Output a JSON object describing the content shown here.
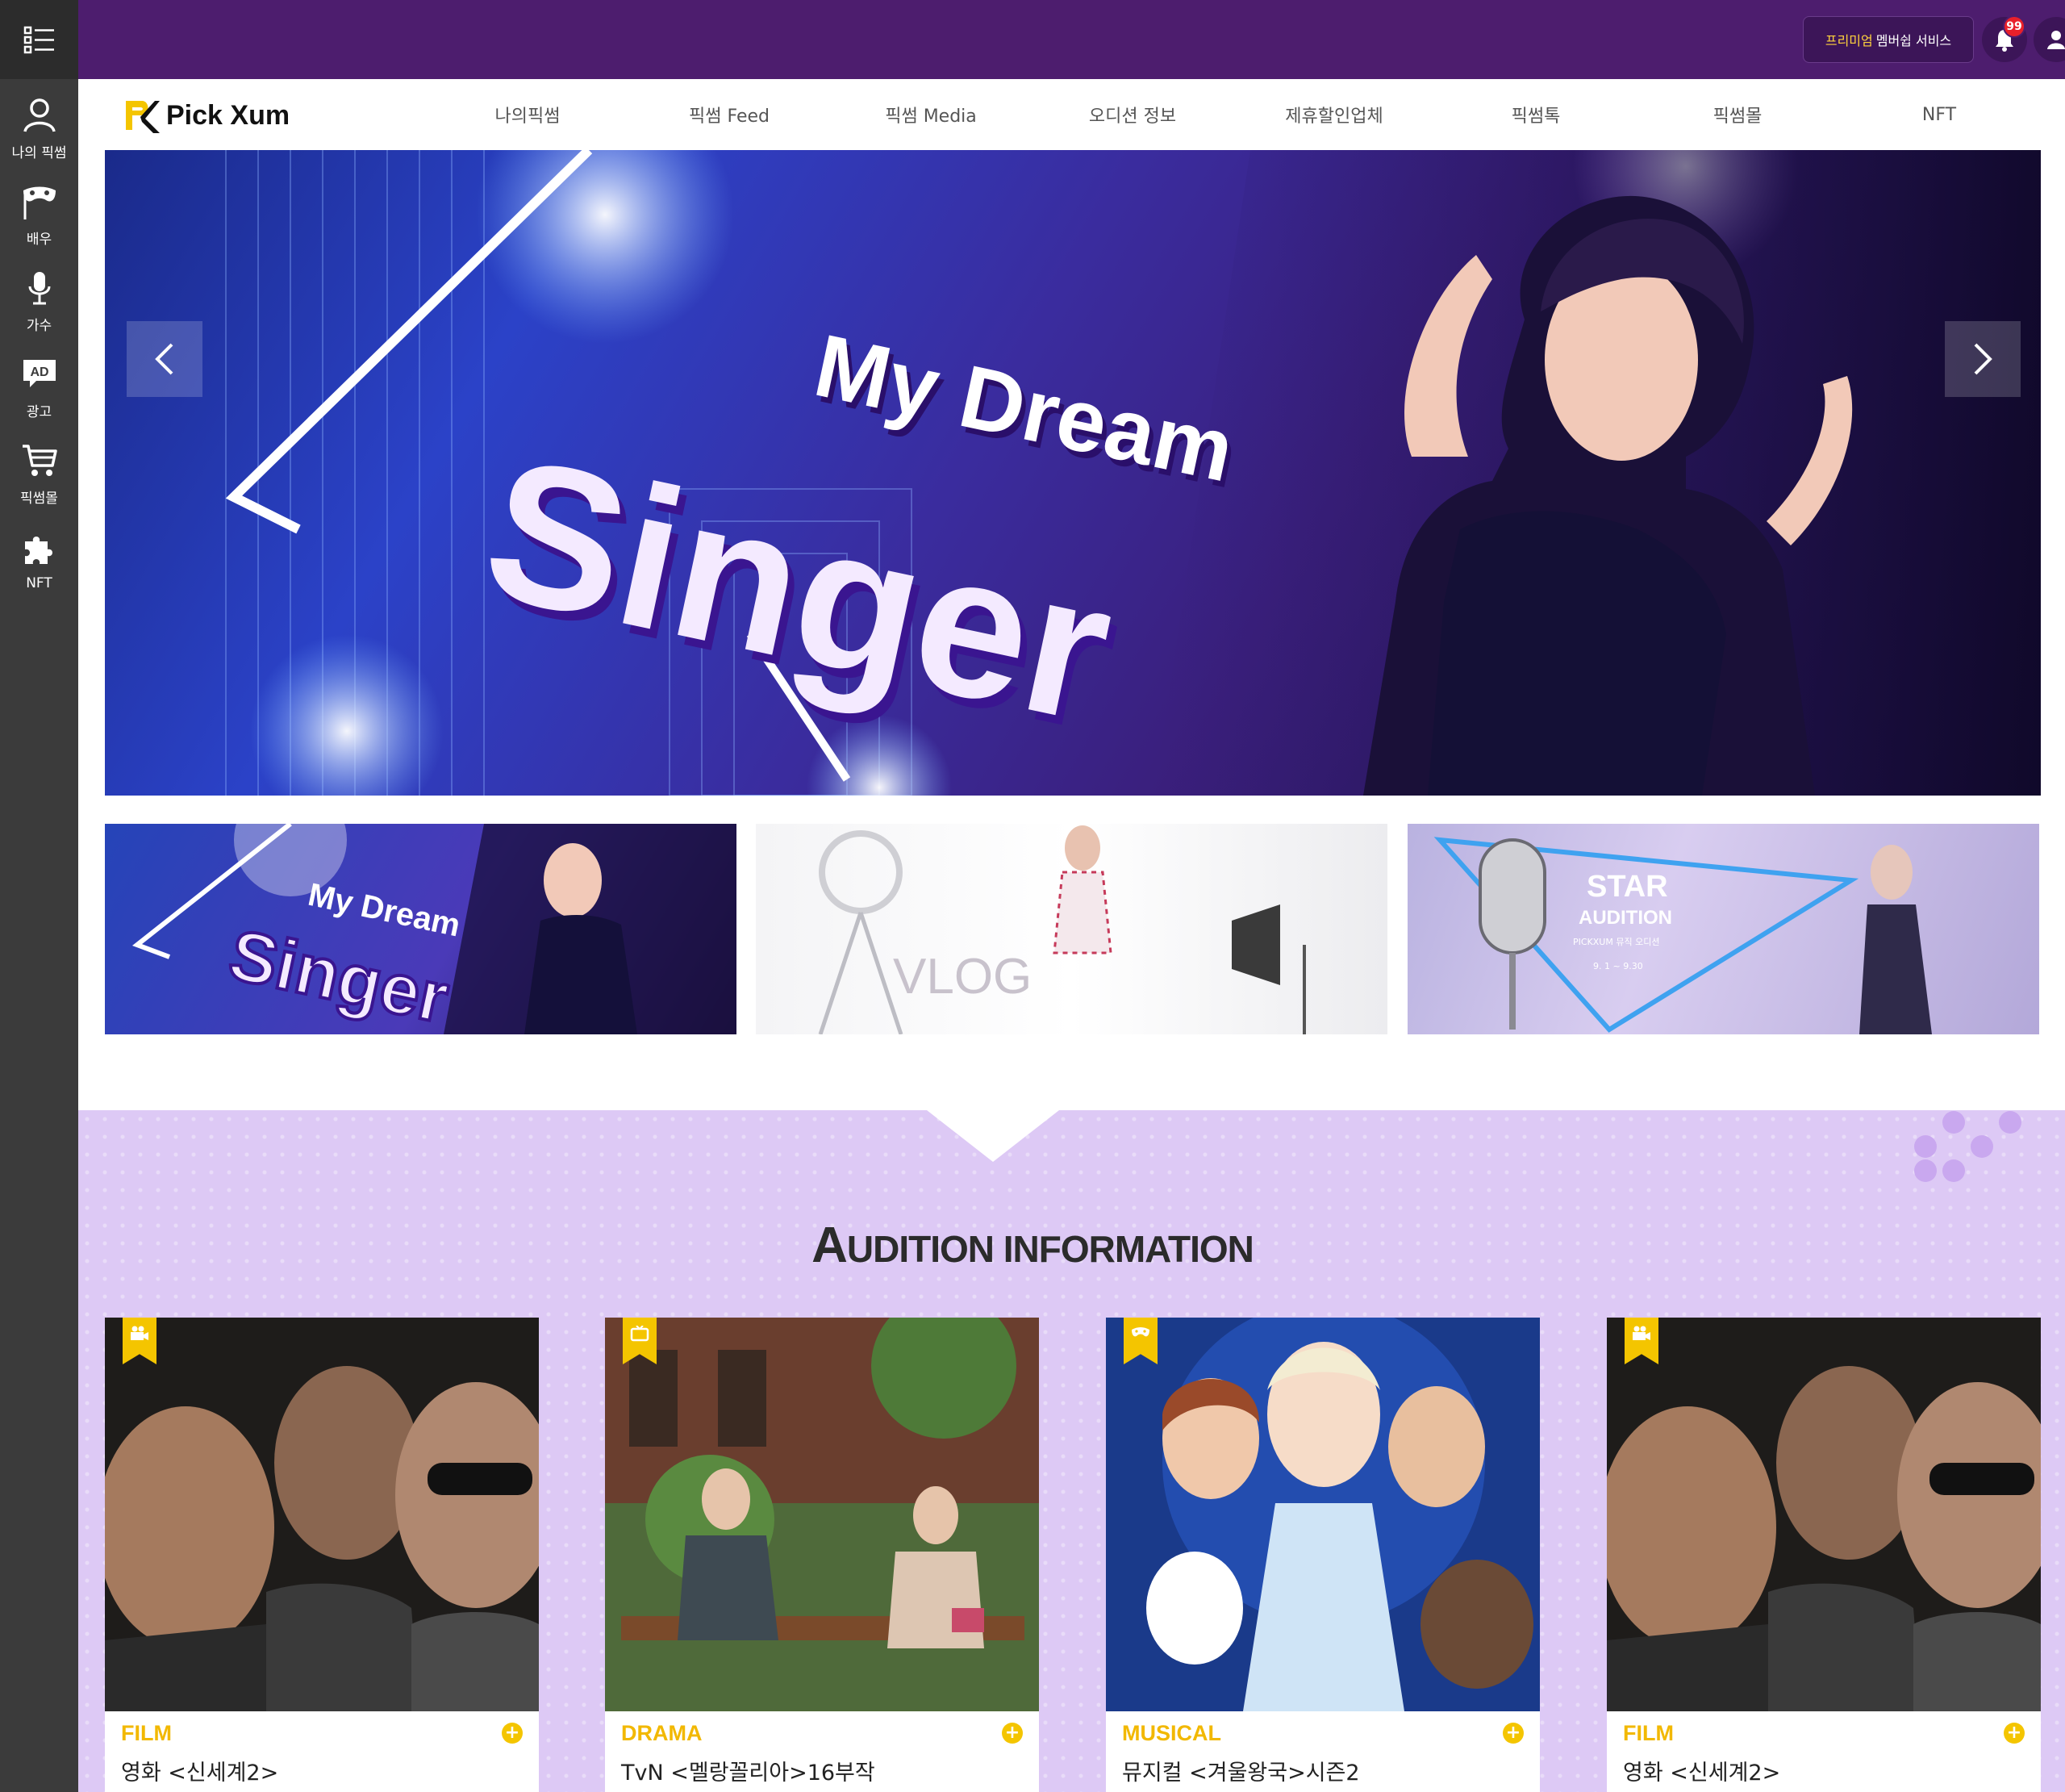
{
  "sidebar": {
    "items": [
      {
        "label": "나의 픽썸",
        "icon": "user-icon"
      },
      {
        "label": "배우",
        "icon": "mask-icon"
      },
      {
        "label": "가수",
        "icon": "microphone-icon"
      },
      {
        "label": "광고",
        "icon": "ad-icon"
      },
      {
        "label": "픽썸몰",
        "icon": "cart-icon"
      },
      {
        "label": "NFT",
        "icon": "puzzle-icon"
      }
    ]
  },
  "topbar": {
    "premium_highlight": "프리미엄",
    "premium_rest": "멤버쉽 서비스",
    "notification_count": "99"
  },
  "header": {
    "logo_text": "Pick Xum",
    "nav": [
      "나의픽썸",
      "픽썸 Feed",
      "픽썸 Media",
      "오디션 정보",
      "제휴할인업체",
      "픽썸톡",
      "픽썸몰",
      "NFT"
    ]
  },
  "hero": {
    "line1": "My Dream",
    "line2": "Singer"
  },
  "banners": {
    "b1_line1": "My Dream",
    "b1_line2": "Singer",
    "b2_text": "VLOG",
    "b3_line1": "STAR",
    "b3_line2": "AUDITION",
    "b3_line3": "PICKXUM 뮤직 오디션",
    "b3_dates": "9. 1 ~ 9.30"
  },
  "audition": {
    "title_first": "A",
    "title_rest": "UDITION INFORMATION",
    "cards": [
      {
        "category": "FILM",
        "title": "영화 <신세계2>",
        "icon": "film-camera-icon"
      },
      {
        "category": "DRAMA",
        "title": "TvN <멜랑꼴리아>16부작",
        "icon": "tv-icon"
      },
      {
        "category": "MUSICAL",
        "title": "뮤지컬 <겨울왕국>시즌2",
        "icon": "mask-icon"
      },
      {
        "category": "FILM",
        "title": "영화 <신세계2>",
        "icon": "film-camera-icon"
      }
    ]
  },
  "colors": {
    "topbar": "#4d1d6e",
    "accent_yellow": "#f4c500",
    "rail": "#3b3b3b",
    "section_bg": "#ddc9f5"
  }
}
